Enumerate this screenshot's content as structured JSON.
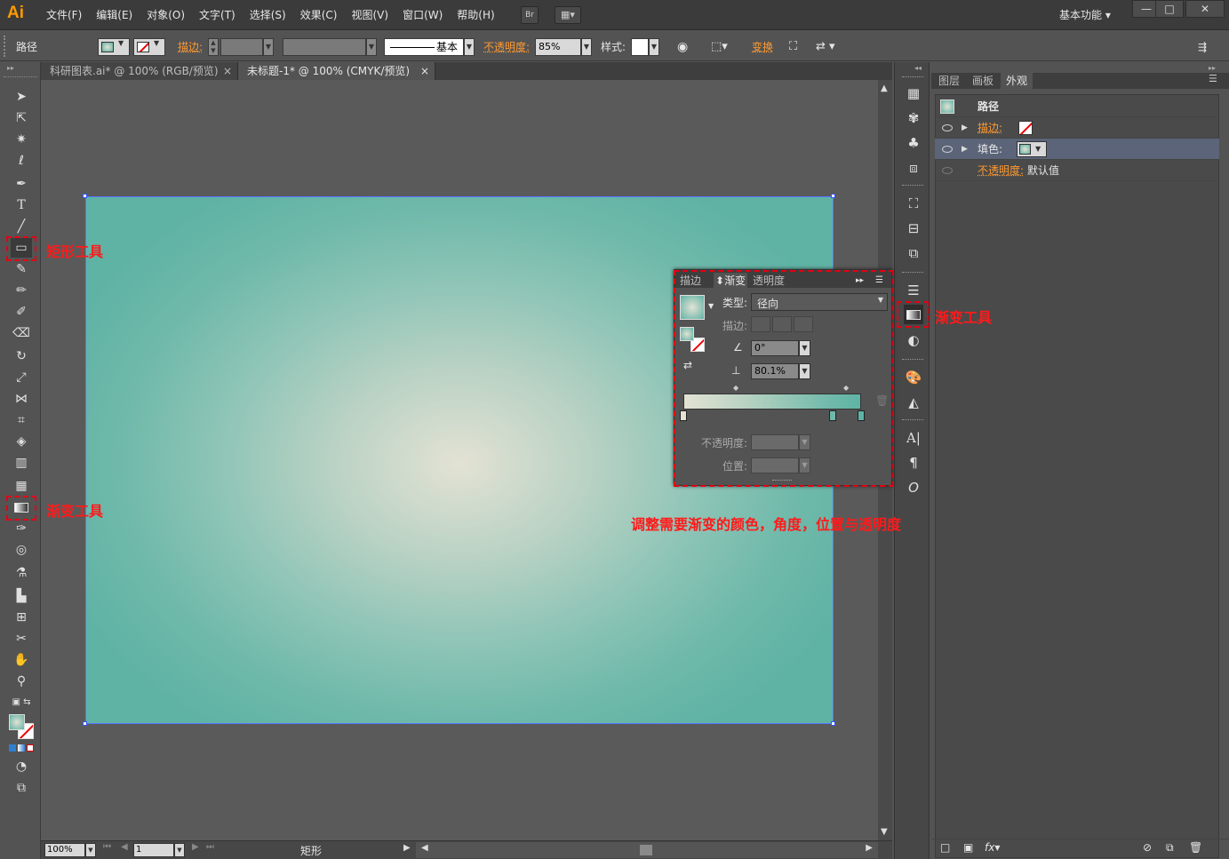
{
  "app": {
    "logo": "Ai",
    "workspace": "基本功能"
  },
  "menu": [
    "文件(F)",
    "编辑(E)",
    "对象(O)",
    "文字(T)",
    "选择(S)",
    "效果(C)",
    "视图(V)",
    "窗口(W)",
    "帮助(H)"
  ],
  "menu_buttons": {
    "bridge": "Br"
  },
  "control": {
    "object_type": "路径",
    "stroke_label": "描边:",
    "stroke_style": "基本",
    "opacity_label": "不透明度:",
    "opacity_value": "85%",
    "style_label": "样式:",
    "transform_label": "变换"
  },
  "tabs": [
    {
      "label": "科研图表.ai* @ 100% (RGB/预览)",
      "close": "×"
    },
    {
      "label": "未标题-1* @ 100% (CMYK/预览)",
      "close": "×"
    }
  ],
  "status": {
    "zoom": "100%",
    "page": "1",
    "tool_name": "矩形"
  },
  "appearance_panel": {
    "tabs": [
      "图层",
      "画板",
      "外观"
    ],
    "title": "路径",
    "rows": [
      {
        "label": "描边:"
      },
      {
        "label": "填色:"
      },
      {
        "label": "不透明度:",
        "value": "默认值"
      }
    ]
  },
  "gradient_panel": {
    "tabs": [
      "描边",
      "渐变",
      "透明度"
    ],
    "type_label": "类型:",
    "type_value": "径向",
    "stroke_label": "描边:",
    "angle_value": "0°",
    "aspect_value": "80.1%",
    "opacity_label": "不透明度:",
    "position_label": "位置:"
  },
  "annotations": {
    "rect_tool": "矩形工具",
    "gradient_tool_left": "渐变工具",
    "gradient_tool_right": "渐变工具",
    "instruction": "调整需要渐变的颜色，角度，位置与透明度"
  },
  "colors": {
    "gradient_center": "#e3e2d4",
    "gradient_edge": "#5fb3a5",
    "annotation": "#e60012",
    "accent_orange": "#ff9a32",
    "selection": "#5577ff"
  }
}
